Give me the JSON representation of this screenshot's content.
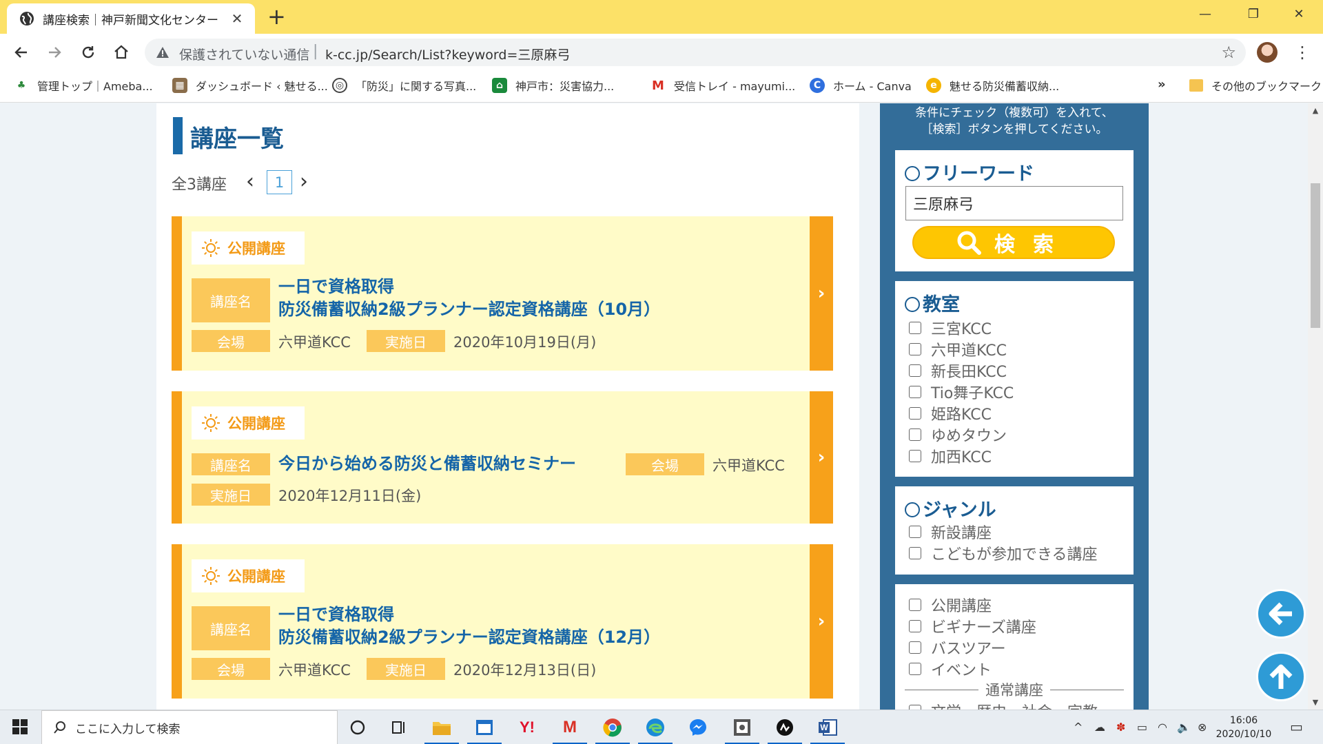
{
  "browser": {
    "tab_title": "講座検索｜神戸新聞文化センター",
    "security_label": "保護されていない通信",
    "url": "k-cc.jp/Search/List?keyword=三原麻弓",
    "bookmarks": [
      {
        "label": "管理トップ｜Ameba...",
        "icon": "ameba-icon",
        "color": "#2d8a3c",
        "glyph": "♣"
      },
      {
        "label": "ダッシュボード ‹ 魅せる...",
        "icon": "dashboard-thumb-icon",
        "color": "#8a6d4b",
        "glyph": "▦"
      },
      {
        "label": "「防災」に関する写真...",
        "icon": "photo-site-icon",
        "color": "#444444",
        "glyph": "◎"
      },
      {
        "label": "神戸市：災害協力...",
        "icon": "kobe-city-icon",
        "color": "#1a8a3c",
        "glyph": "⌂"
      },
      {
        "label": "受信トレイ - mayumi...",
        "icon": "gmail-icon",
        "color": "#d93025",
        "glyph": "M"
      },
      {
        "label": "ホーム - Canva",
        "icon": "canva-icon",
        "color": "#2f6fde",
        "glyph": "C"
      },
      {
        "label": "魅せる防災備蓄収納...",
        "icon": "blog-icon",
        "color": "#f5b400",
        "glyph": "e"
      }
    ],
    "more_bookmarks": "»",
    "other_bookmarks": "その他のブックマーク"
  },
  "main": {
    "heading": "講座一覧",
    "pager": {
      "count": "全3講座",
      "current": "1"
    },
    "badge_label": "公開講座",
    "labels": {
      "name": "講座名",
      "venue": "会場",
      "date": "実施日"
    },
    "courses": [
      {
        "title_line1": "一日で資格取得",
        "title_line2": "防災備蓄収納2級プランナー認定資格講座（10月）",
        "venue": "六甲道KCC",
        "date": "2020年10月19日(月)"
      },
      {
        "title": "今日から始める防災と備蓄収納セミナー",
        "venue": "六甲道KCC",
        "date": "2020年12月11日(金)"
      },
      {
        "title_line1": "一日で資格取得",
        "title_line2": "防災備蓄収納2級プランナー認定資格講座（12月）",
        "venue": "六甲道KCC",
        "date": "2020年12月13日(日)"
      }
    ]
  },
  "sidebar": {
    "note_line1": "条件にチェック（複数可）を入れて、",
    "note_line2": "［検索］ボタンを押してください。",
    "freeword": {
      "heading": "フリーワード",
      "value": "三原麻弓",
      "button": "検索"
    },
    "classroom": {
      "heading": "教室",
      "items": [
        "三宮KCC",
        "六甲道KCC",
        "新長田KCC",
        "Tio舞子KCC",
        "姫路KCC",
        "ゆめタウン",
        "加西KCC"
      ]
    },
    "genre": {
      "heading": "ジャンル",
      "items": [
        "新設講座",
        "こどもが参加できる講座"
      ]
    },
    "types": {
      "items": [
        "公開講座",
        "ビギナーズ講座",
        "バスツアー",
        "イベント"
      ],
      "subheading": "通常講座",
      "partial": "文学・歴史・社会・宗教"
    }
  },
  "taskbar": {
    "search_placeholder": "ここに入力して検索",
    "time": "16:06",
    "date": "2020/10/10"
  },
  "colors": {
    "accent_orange": "#f7a11a",
    "card_bg": "#fffbc8",
    "label_bg": "#fbc85a",
    "title_blue": "#1565a8",
    "sidebar_blue": "#336d99",
    "search_yellow": "#fec602",
    "chrome_yellow": "#fce168"
  }
}
